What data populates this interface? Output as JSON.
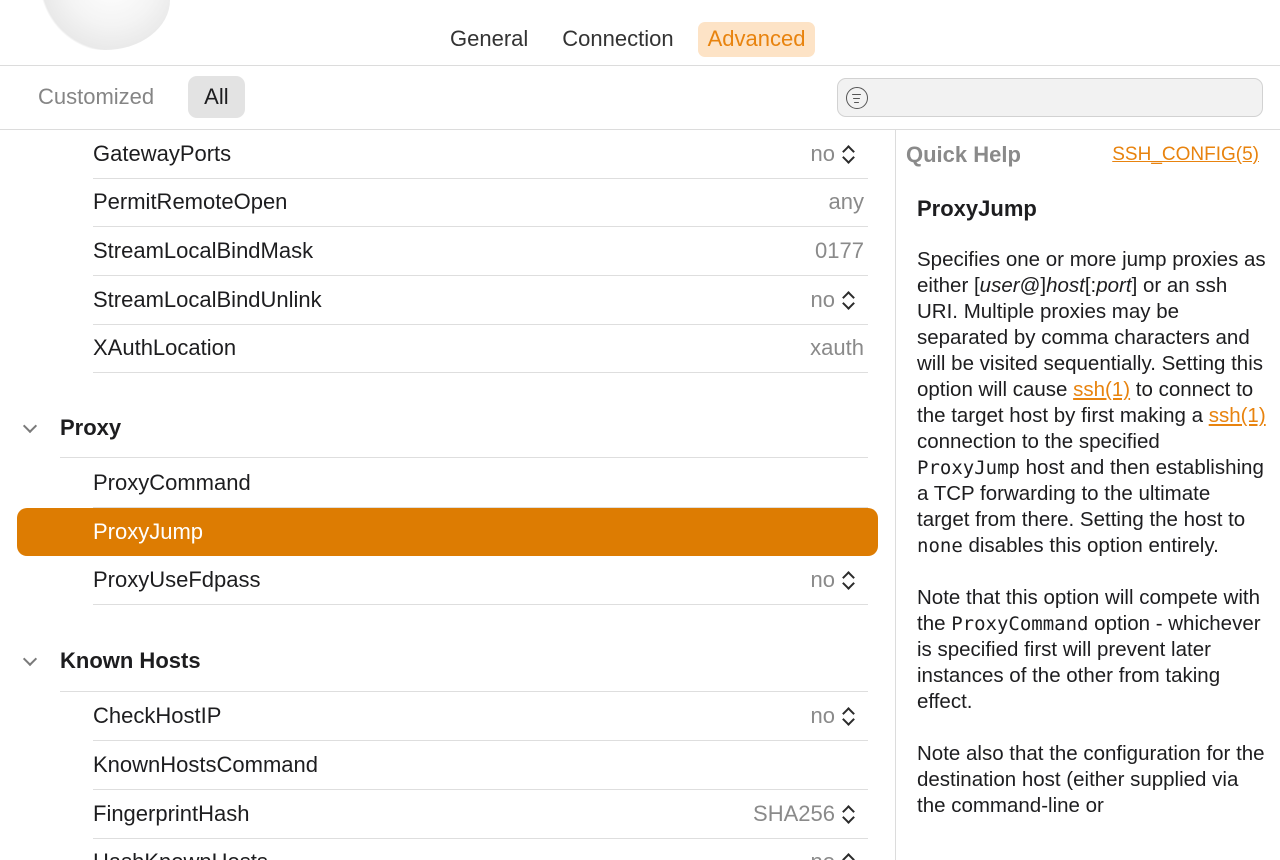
{
  "toolbar": {
    "tabs": [
      {
        "label": "General",
        "active": false
      },
      {
        "label": "Connection",
        "active": false
      },
      {
        "label": "Advanced",
        "active": true
      }
    ]
  },
  "filter": {
    "segments": [
      {
        "label": "Customized",
        "active": false
      },
      {
        "label": "All",
        "active": true
      }
    ],
    "search": {
      "value": "",
      "placeholder": "",
      "icon": "filter-icon"
    }
  },
  "list": {
    "rows_top": [
      {
        "label": "GatewayPorts",
        "value": "no",
        "stepper": true
      },
      {
        "label": "PermitRemoteOpen",
        "value": "any",
        "stepper": false
      },
      {
        "label": "StreamLocalBindMask",
        "value": "0177",
        "stepper": false
      },
      {
        "label": "StreamLocalBindUnlink",
        "value": "no",
        "stepper": true
      },
      {
        "label": "XAuthLocation",
        "value": "xauth",
        "stepper": false
      }
    ],
    "sections": [
      {
        "title": "Proxy",
        "expanded": true,
        "rows": [
          {
            "label": "ProxyCommand",
            "value": "",
            "stepper": false
          },
          {
            "label": "ProxyJump",
            "value": "",
            "stepper": false,
            "selected": true
          },
          {
            "label": "ProxyUseFdpass",
            "value": "no",
            "stepper": true
          }
        ]
      },
      {
        "title": "Known Hosts",
        "expanded": true,
        "rows": [
          {
            "label": "CheckHostIP",
            "value": "no",
            "stepper": true
          },
          {
            "label": "KnownHostsCommand",
            "value": "",
            "stepper": false
          },
          {
            "label": "FingerprintHash",
            "value": "SHA256",
            "stepper": true
          },
          {
            "label": "HashKnownHosts",
            "value": "no",
            "stepper": true
          }
        ]
      }
    ]
  },
  "help": {
    "heading": "Quick Help",
    "link": "SSH_CONFIG(5)",
    "title": "ProxyJump",
    "p1": {
      "t1": "Specifies one or more jump proxies as either [",
      "user": "user",
      "t2": "@]",
      "host": "host",
      "t3": "[:",
      "port": "port",
      "t4": "] or an ssh URI. Multiple proxies may be separated by comma characters and will be visited sequentially. Setting this option will cause ",
      "link1": "ssh(1)",
      "t5": " to connect to the target host by first making a ",
      "link2": "ssh(1)",
      "t6": " connection to the specified ",
      "code1": "ProxyJump",
      "t7": " host and then establishing a TCP forwarding to the ultimate target from there. Setting the host to ",
      "code2": "none",
      "t8": " disables this option entirely."
    },
    "p2": {
      "t1": "Note that this option will compete with the ",
      "code1": "ProxyCommand",
      "t2": " option - whichever is specified first will prevent later instances of the other from taking effect."
    },
    "p3": "Note also that the configuration for the destination host (either supplied via the command-line or"
  },
  "colors": {
    "accent": "#dd7c02",
    "accent_text": "#e8830e",
    "tab_active_bg": "#fde3c6"
  }
}
